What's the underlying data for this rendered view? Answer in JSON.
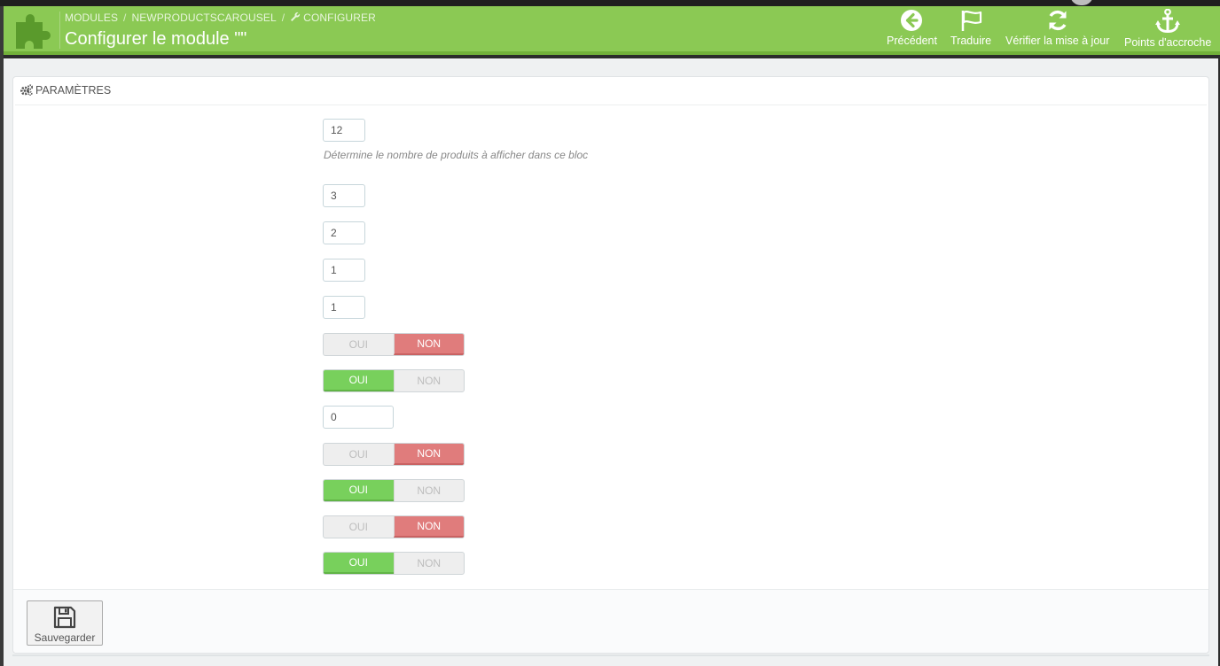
{
  "header": {
    "breadcrumb": [
      "MODULES",
      "NEWPRODUCTSCAROUSEL",
      "CONFIGURER"
    ],
    "separator": "/",
    "title": "Configurer le module \"\"",
    "toolbar": [
      {
        "label": "Précédent",
        "icon": "arrow-left-circle-icon"
      },
      {
        "label": "Traduire",
        "icon": "flag-icon"
      },
      {
        "label": "Vérifier la mise à jour",
        "icon": "refresh-icon"
      },
      {
        "label": "Points d'accroche",
        "icon": "anchor-icon"
      }
    ]
  },
  "panel": {
    "heading": "PARAMÈTRES",
    "heading_icon": "cogs-icon",
    "help_text": "Détermine le nombre de produits à afficher dans ce bloc",
    "fields": [
      {
        "type": "input",
        "value": "12"
      },
      {
        "type": "input",
        "value": "3"
      },
      {
        "type": "input",
        "value": "2"
      },
      {
        "type": "input",
        "value": "1"
      },
      {
        "type": "input",
        "value": "1"
      },
      {
        "type": "switch",
        "value": "NON"
      },
      {
        "type": "switch",
        "value": "OUI"
      },
      {
        "type": "input",
        "value": "0"
      },
      {
        "type": "switch",
        "value": "NON"
      },
      {
        "type": "switch",
        "value": "OUI"
      },
      {
        "type": "switch",
        "value": "NON"
      },
      {
        "type": "switch",
        "value": "OUI"
      }
    ],
    "switch_labels": {
      "yes": "OUI",
      "no": "NON"
    },
    "colors": {
      "yes": "#78d05c",
      "no": "#e07c7c",
      "header": "#8bc954"
    }
  },
  "footer": {
    "save_label": "Sauvegarder",
    "save_icon": "floppy-disk-icon"
  }
}
